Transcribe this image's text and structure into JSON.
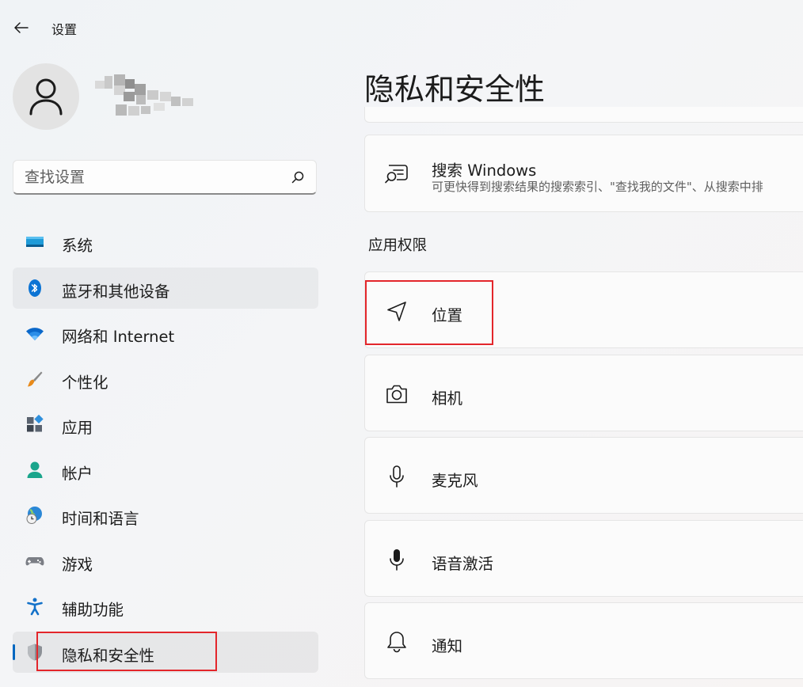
{
  "window": {
    "title": "设置"
  },
  "search": {
    "placeholder": "查找设置"
  },
  "nav": {
    "items": [
      {
        "label": "系统"
      },
      {
        "label": "蓝牙和其他设备"
      },
      {
        "label": "网络和 Internet"
      },
      {
        "label": "个性化"
      },
      {
        "label": "应用"
      },
      {
        "label": "帐户"
      },
      {
        "label": "时间和语言"
      },
      {
        "label": "游戏"
      },
      {
        "label": "辅助功能"
      },
      {
        "label": "隐私和安全性"
      }
    ]
  },
  "main": {
    "title": "隐私和安全性",
    "search_windows": {
      "title": "搜索 Windows",
      "desc": "可更快得到搜索结果的搜索索引、\"查找我的文件\"、从搜索中排"
    },
    "section_title": "应用权限",
    "permissions": [
      {
        "label": "位置"
      },
      {
        "label": "相机"
      },
      {
        "label": "麦克风"
      },
      {
        "label": "语音激活"
      },
      {
        "label": "通知"
      }
    ]
  },
  "colors": {
    "accent": "#0067c0",
    "annotation": "#e3262b"
  }
}
